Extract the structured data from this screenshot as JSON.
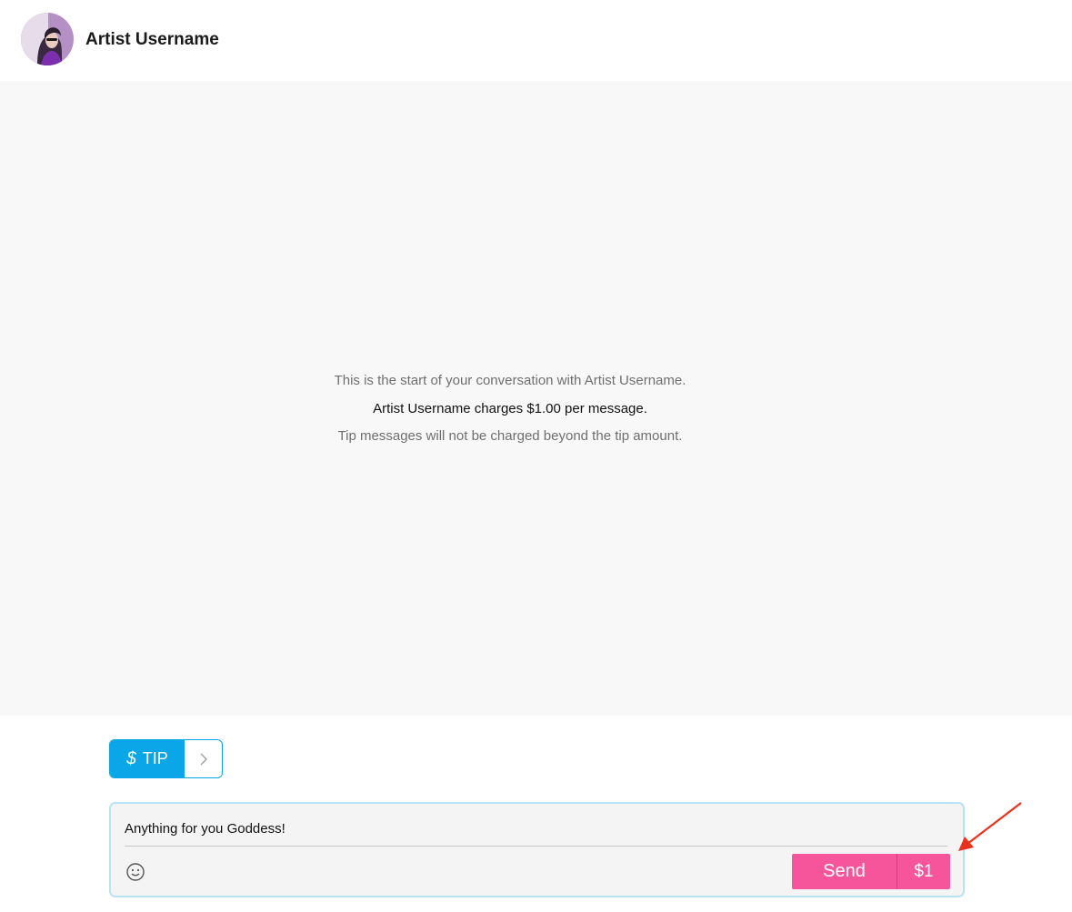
{
  "header": {
    "username": "Artist Username",
    "avatar_icon": "avatar-portrait"
  },
  "conversation": {
    "intro_line_1": "This is the start of your conversation with Artist Username.",
    "intro_line_2": "Artist Username charges $1.00 per message.",
    "intro_line_3": "Tip messages will not be charged beyond the tip amount."
  },
  "tip": {
    "icon": "$",
    "label": "TIP",
    "chevron_icon": "chevron-right-icon"
  },
  "composer": {
    "message_value": "Anything for you Goddess!",
    "emoji_icon": "smiley-icon",
    "send_label": "Send",
    "price_label": "$1"
  },
  "colors": {
    "accent_blue": "#0aa6e8",
    "send_pink": "#f7559b",
    "annotation_red": "#e8321e"
  }
}
